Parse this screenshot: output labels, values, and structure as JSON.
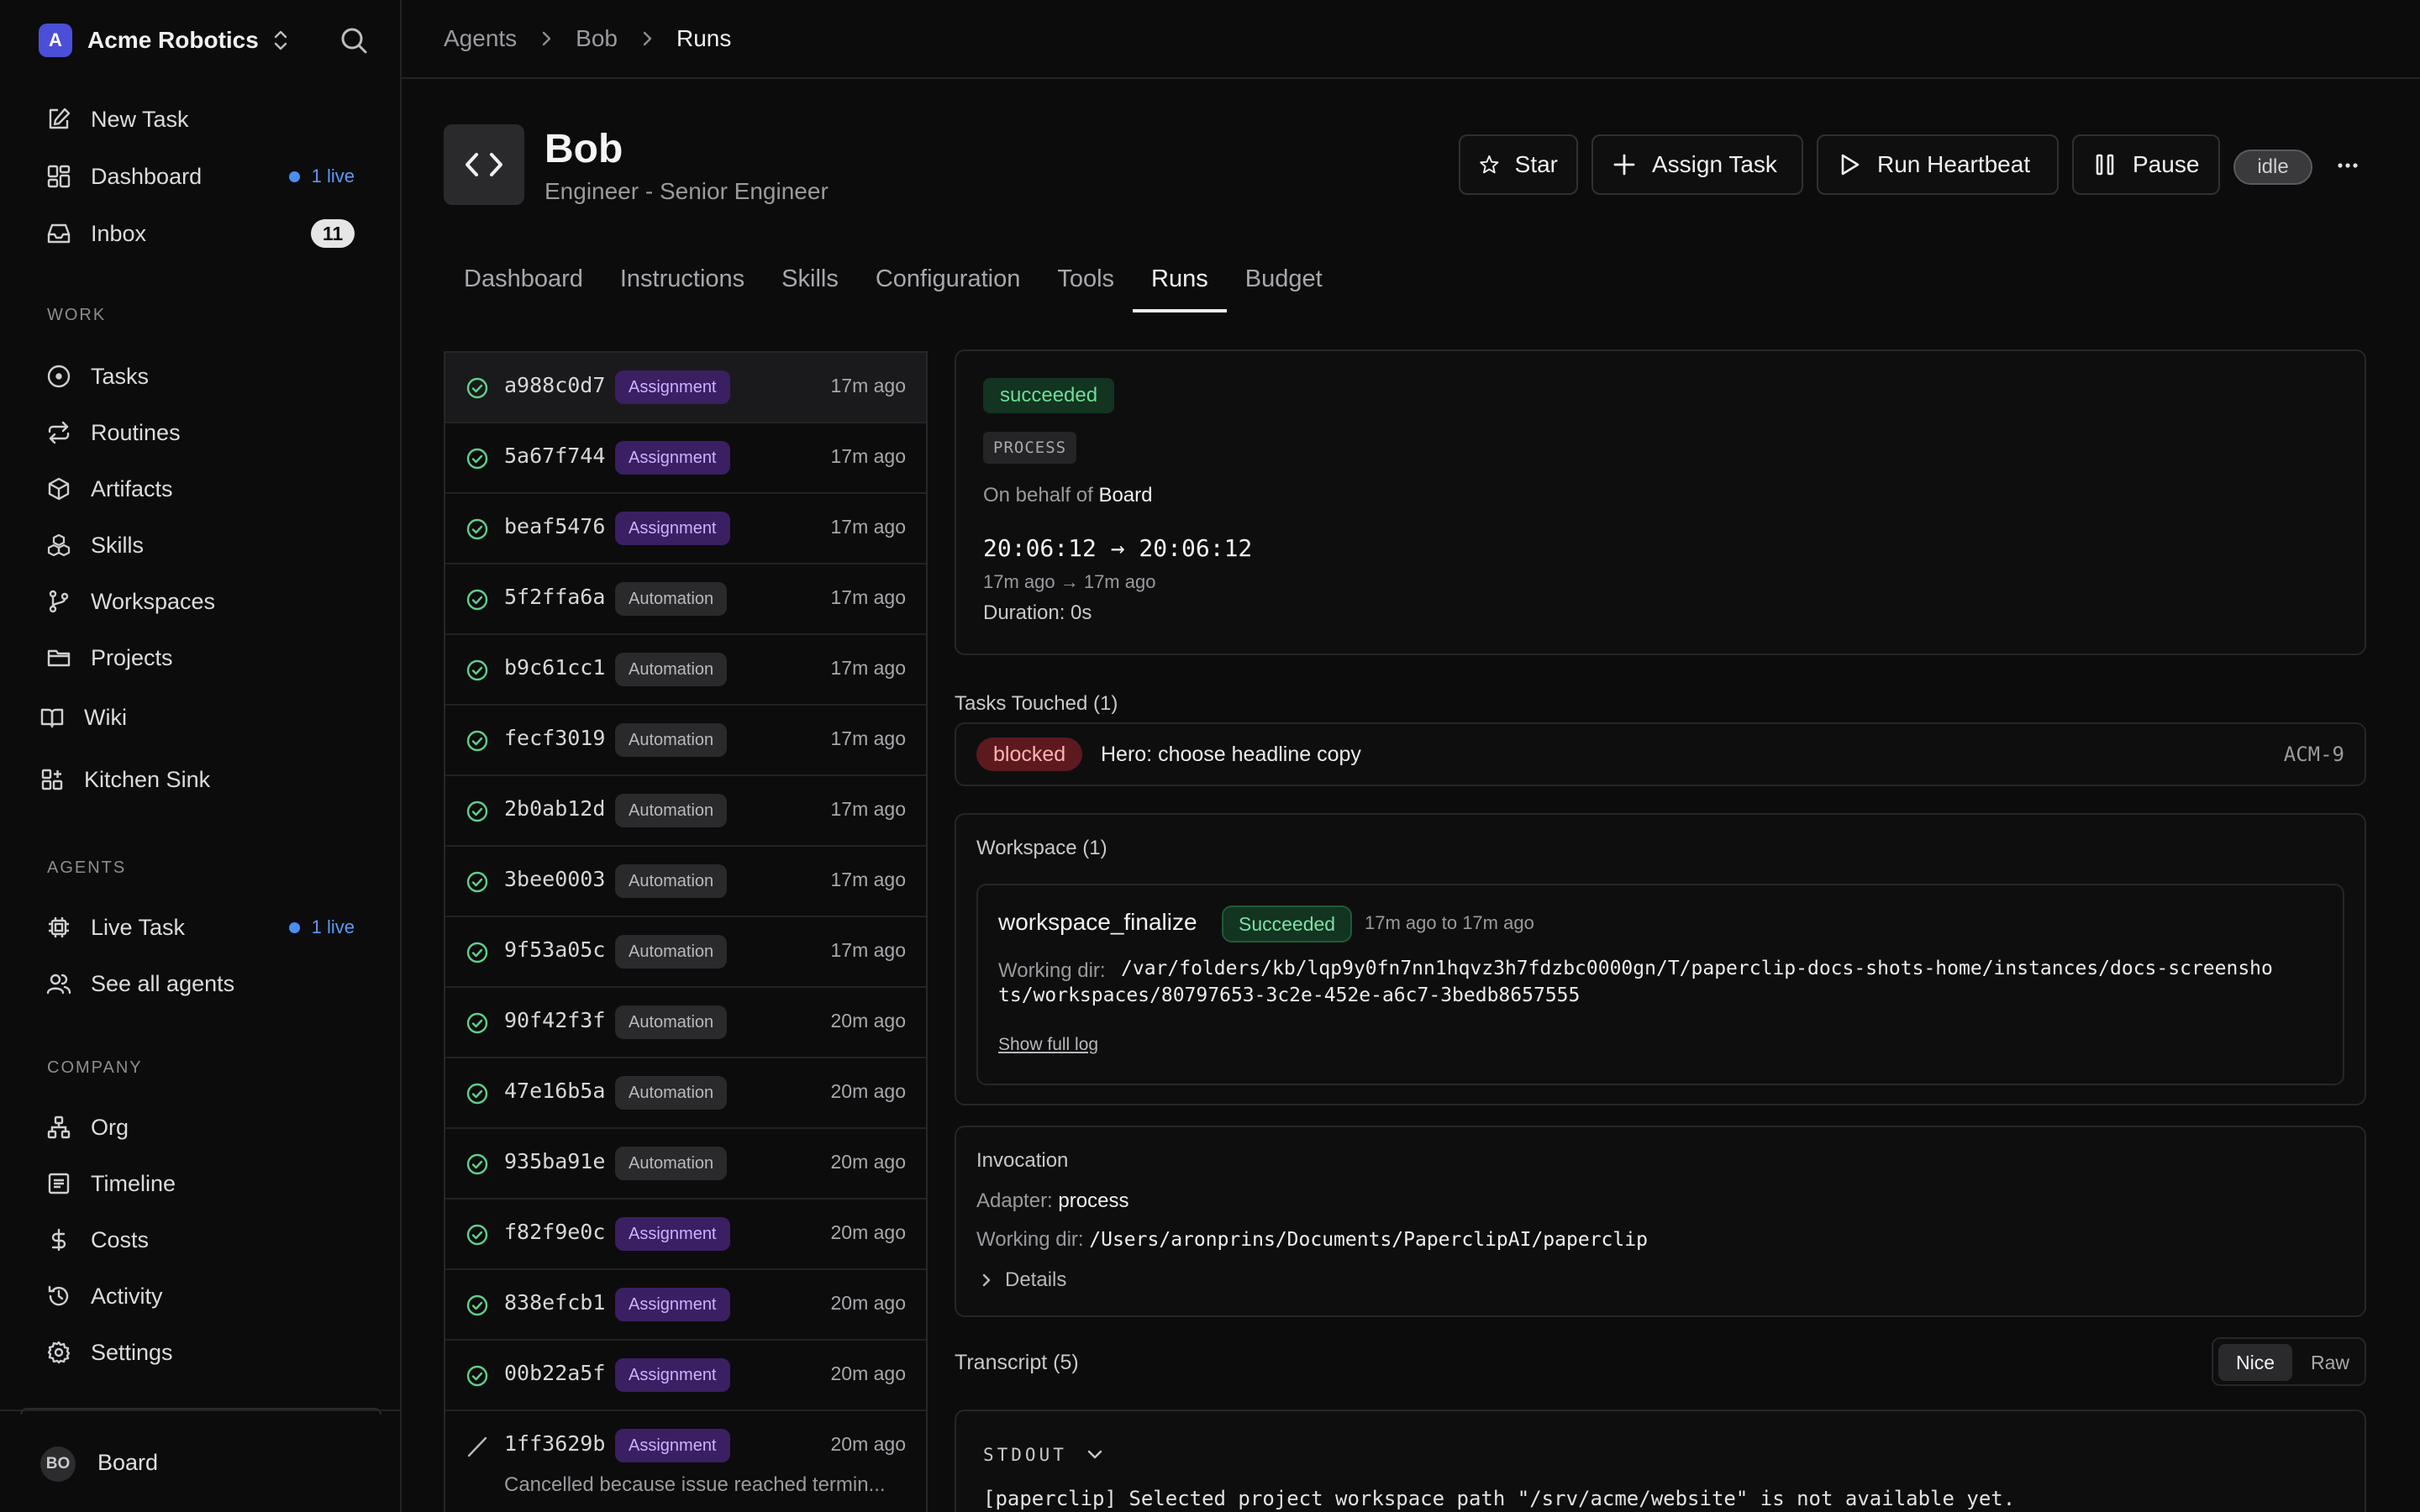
{
  "brand": {
    "logo_letter": "A",
    "name": "Acme Robotics"
  },
  "sidebar": {
    "top_items": [
      {
        "label": "New Task"
      },
      {
        "label": "Dashboard",
        "live": "1 live"
      },
      {
        "label": "Inbox",
        "count": "11"
      }
    ],
    "work_title": "WORK",
    "work_items": [
      {
        "label": "Tasks"
      },
      {
        "label": "Routines"
      },
      {
        "label": "Artifacts"
      },
      {
        "label": "Skills"
      },
      {
        "label": "Workspaces"
      },
      {
        "label": "Projects"
      },
      {
        "label": "Wiki"
      },
      {
        "label": "Kitchen Sink"
      }
    ],
    "agents_title": "AGENTS",
    "agent_items": [
      {
        "label": "Live Task",
        "live": "1 live"
      },
      {
        "label": "See all agents"
      }
    ],
    "company_title": "COMPANY",
    "company_items": [
      {
        "label": "Org"
      },
      {
        "label": "Timeline"
      },
      {
        "label": "Costs"
      },
      {
        "label": "Activity"
      },
      {
        "label": "Settings"
      }
    ],
    "footer": {
      "initials": "BO",
      "user": "Board"
    }
  },
  "breadcrumb": [
    "Agents",
    "Bob",
    "Runs"
  ],
  "agent": {
    "name": "Bob",
    "role": "Engineer - Senior Engineer",
    "status": "idle"
  },
  "actions": {
    "star": "Star",
    "assign": "Assign Task",
    "heartbeat": "Run Heartbeat",
    "pause": "Pause",
    "more": "···"
  },
  "tabs": [
    "Dashboard",
    "Instructions",
    "Skills",
    "Configuration",
    "Tools",
    "Runs",
    "Budget"
  ],
  "active_tab": "Runs",
  "runs": [
    {
      "id": "a988c0d7",
      "tag": "Assignment",
      "ago": "17m ago"
    },
    {
      "id": "5a67f744",
      "tag": "Assignment",
      "ago": "17m ago"
    },
    {
      "id": "beaf5476",
      "tag": "Assignment",
      "ago": "17m ago"
    },
    {
      "id": "5f2ffa6a",
      "tag": "Automation",
      "ago": "17m ago"
    },
    {
      "id": "b9c61cc1",
      "tag": "Automation",
      "ago": "17m ago"
    },
    {
      "id": "fecf3019",
      "tag": "Automation",
      "ago": "17m ago"
    },
    {
      "id": "2b0ab12d",
      "tag": "Automation",
      "ago": "17m ago"
    },
    {
      "id": "3bee0003",
      "tag": "Automation",
      "ago": "17m ago"
    },
    {
      "id": "9f53a05c",
      "tag": "Automation",
      "ago": "17m ago"
    },
    {
      "id": "90f42f3f",
      "tag": "Automation",
      "ago": "20m ago"
    },
    {
      "id": "47e16b5a",
      "tag": "Automation",
      "ago": "20m ago"
    },
    {
      "id": "935ba91e",
      "tag": "Automation",
      "ago": "20m ago"
    },
    {
      "id": "f82f9e0c",
      "tag": "Assignment",
      "ago": "20m ago"
    },
    {
      "id": "838efcb1",
      "tag": "Assignment",
      "ago": "20m ago"
    },
    {
      "id": "00b22a5f",
      "tag": "Assignment",
      "ago": "20m ago"
    },
    {
      "id": "1ff3629b",
      "tag": "Assignment",
      "ago": "20m ago",
      "note": "Cancelled because issue reached termin...",
      "cancelled": true
    }
  ],
  "detail": {
    "status": "succeeded",
    "kind": "PROCESS",
    "behalf_prefix": "On behalf of",
    "behalf_name": "Board",
    "time_range": "20:06:12 → 20:06:12",
    "relative_range": "17m ago → 17m ago",
    "duration": "Duration: 0s"
  },
  "tasks_touched": {
    "title": "Tasks Touched (1)",
    "items": [
      {
        "status": "blocked",
        "title": "Hero: choose headline copy",
        "key": "ACM-9"
      }
    ]
  },
  "workspace": {
    "title": "Workspace (1)",
    "op_name": "workspace_finalize",
    "op_status": "Succeeded",
    "op_time": "17m ago to 17m ago",
    "dir_label": "Working dir:",
    "dir_line1": "/var/folders/kb/lqp9y0fn7nn1hqvz3h7fdzbc0000gn/T/paperclip-docs-shots-home/instances/docs-screensho",
    "dir_line2": "ts/workspaces/80797653-3c2e-452e-a6c7-3bedb8657555",
    "log_link": "Show full log"
  },
  "invocation": {
    "title": "Invocation",
    "adapter_label": "Adapter:",
    "adapter": "process",
    "dir_label": "Working dir:",
    "dir": "/Users/aronprins/Documents/PaperclipAI/paperclip",
    "details": "Details"
  },
  "transcript": {
    "title": "Transcript (5)",
    "mode_nice": "Nice",
    "mode_raw": "Raw",
    "stream": "STDOUT",
    "line": "[paperclip] Selected project workspace path \"/srv/acme/website\" is not available yet."
  },
  "colors": {
    "accent_live": "#4a8ef5",
    "success": "#6fdc98",
    "assignment": "#cdb0ff",
    "blocked": "#5c1a1f"
  }
}
